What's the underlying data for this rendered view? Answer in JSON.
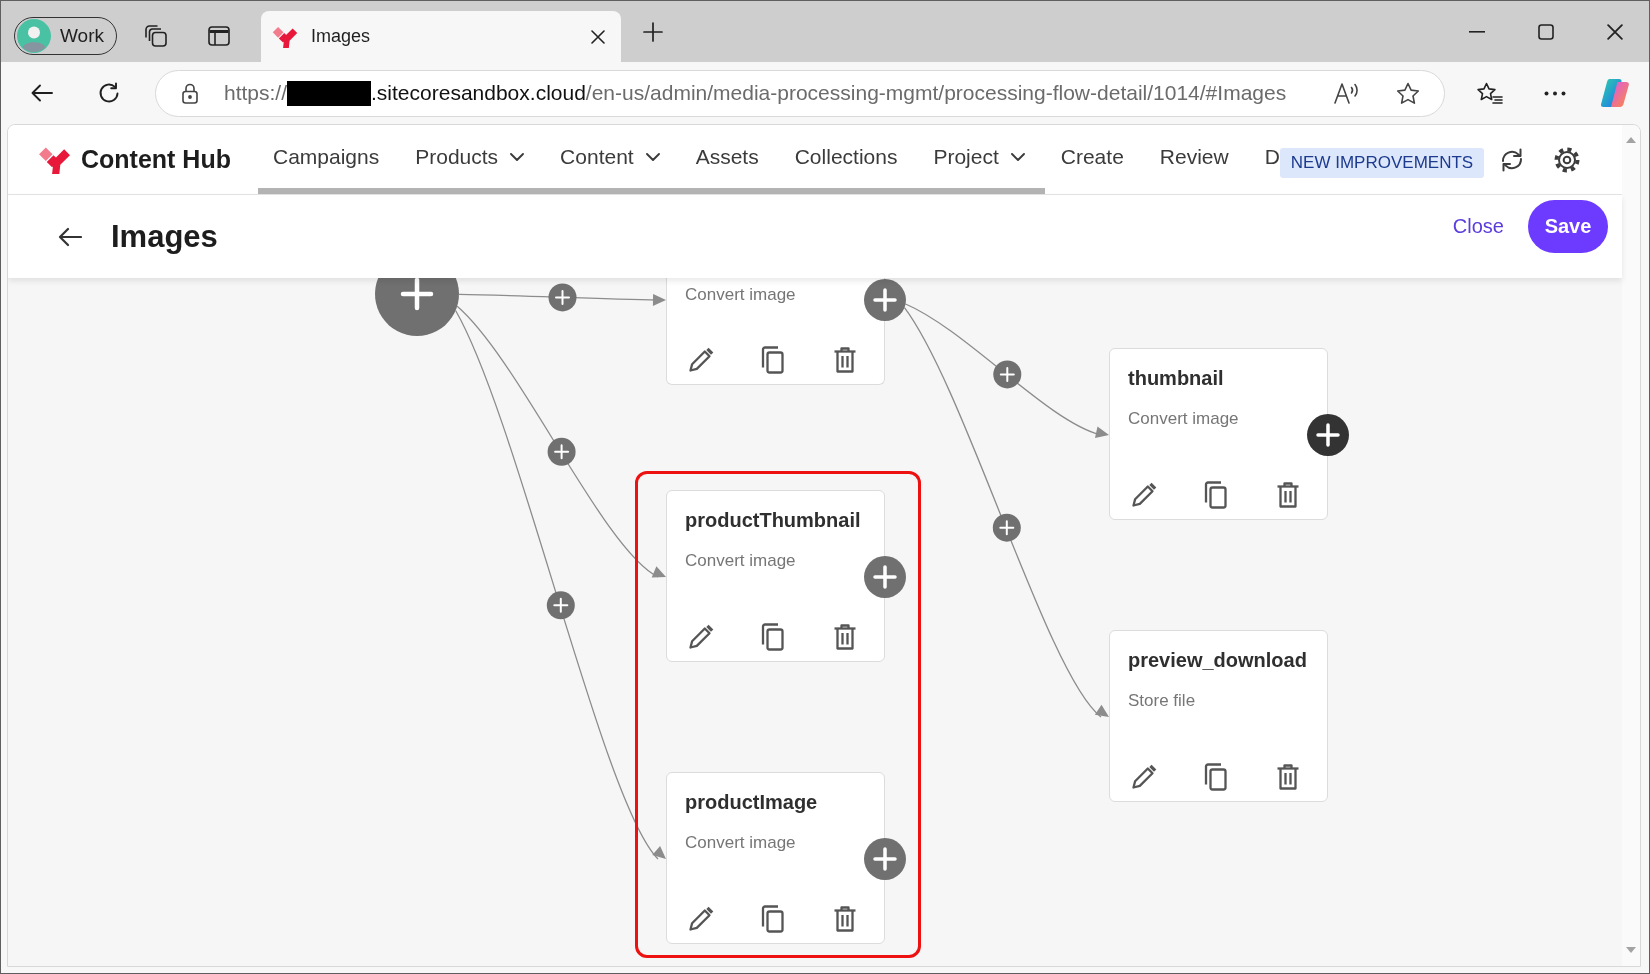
{
  "browser": {
    "profile": {
      "label": "Work"
    },
    "tabs": [
      {
        "title": "Images",
        "selected": true
      }
    ],
    "address": {
      "scheme": "https://",
      "redacted": true,
      "host": ".sitecoresandbox.cloud",
      "path": "/en-us/admin/media-processing-mgmt/processing-flow-detail/1014/#Images"
    }
  },
  "app": {
    "brand": "Content Hub",
    "nav": [
      {
        "label": "Campaigns",
        "dropdown": false
      },
      {
        "label": "Products",
        "dropdown": true
      },
      {
        "label": "Content",
        "dropdown": true
      },
      {
        "label": "Assets",
        "dropdown": false
      },
      {
        "label": "Collections",
        "dropdown": false
      },
      {
        "label": "Project",
        "dropdown": true
      },
      {
        "label": "Create",
        "dropdown": false
      },
      {
        "label": "Review",
        "dropdown": false
      },
      {
        "label": "D",
        "dropdown": false
      }
    ],
    "badge": "NEW IMPROVEMENTS"
  },
  "page": {
    "title": "Images",
    "close": "Close",
    "save": "Save"
  },
  "flow": {
    "steps": [
      {
        "subtitle": "Convert image",
        "add_button": true,
        "add_button_hovered": false,
        "framed": false,
        "children": [
          {
            "title": "thumbnail",
            "subtitle": "Convert image",
            "add_button": true,
            "add_button_hovered": true,
            "framed": false
          },
          {
            "title": "preview_download",
            "subtitle": "Store file",
            "add_button": false,
            "framed": false
          }
        ]
      },
      {
        "title": "productThumbnail",
        "subtitle": "Convert image",
        "add_button": true,
        "add_button_hovered": false,
        "framed": true
      },
      {
        "title": "productImage",
        "subtitle": "Convert image",
        "add_button": true,
        "add_button_hovered": false,
        "framed": true
      }
    ]
  }
}
